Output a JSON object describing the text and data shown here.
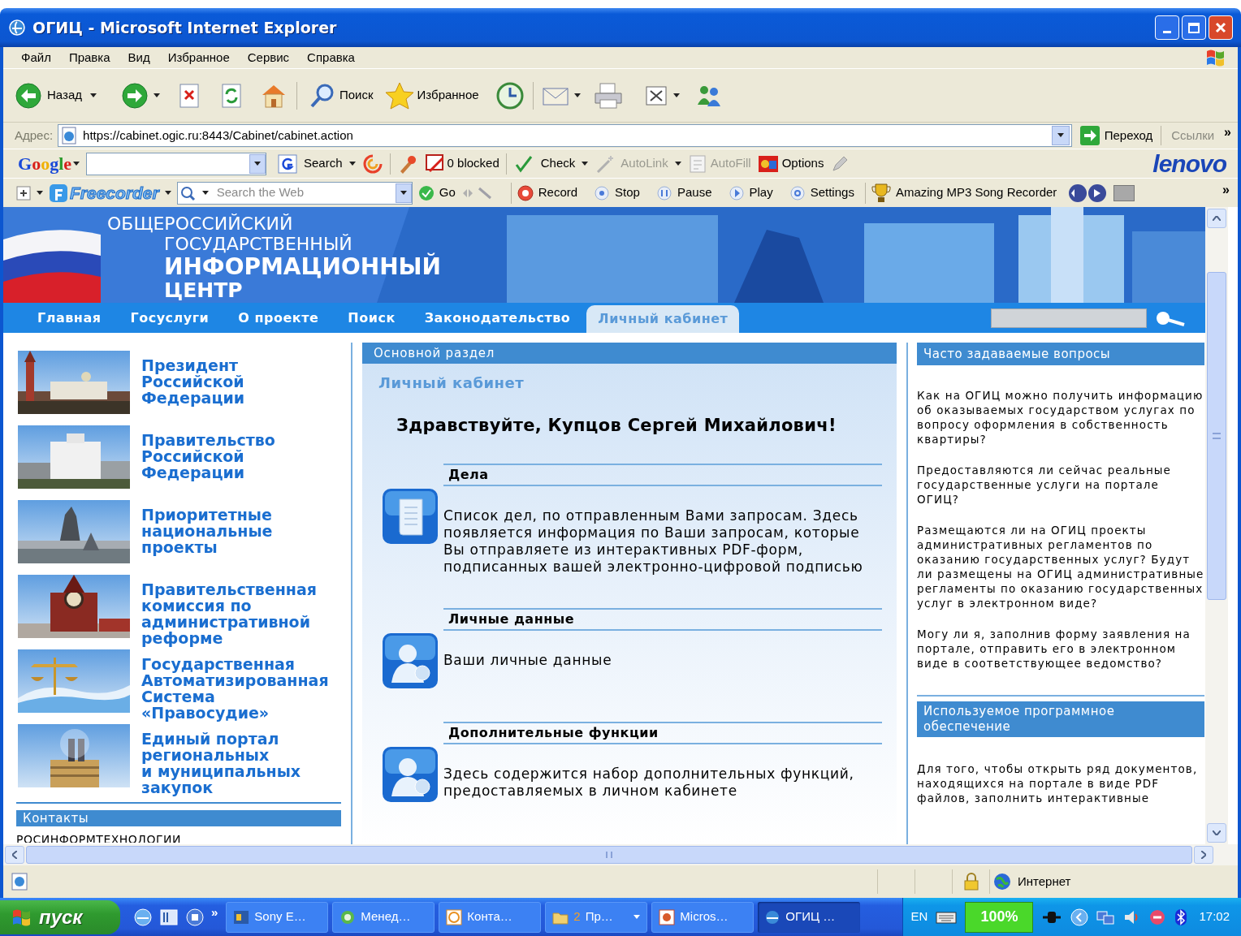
{
  "window": {
    "title": "ОГИЦ - Microsoft Internet Explorer"
  },
  "menu": [
    "Файл",
    "Правка",
    "Вид",
    "Избранное",
    "Сервис",
    "Справка"
  ],
  "toolbar": {
    "back": "Назад",
    "search": "Поиск",
    "favorites": "Избранное"
  },
  "address_bar": {
    "label": "Адрес:",
    "url": "https://cabinet.ogic.ru:8443/Cabinet/cabinet.action",
    "go": "Переход",
    "links": "Ссылки",
    "chevron": "»"
  },
  "google_bar": {
    "logo": "Google",
    "search": "Search",
    "blocked": "0 blocked",
    "check": "Check",
    "autolink": "AutoLink",
    "autofill": "AutoFill",
    "options": "Options",
    "brand": "lenovo"
  },
  "freecorder_bar": {
    "logo": "Freecorder",
    "search_placeholder": "Search the Web",
    "go": "Go",
    "record": "Record",
    "stop": "Stop",
    "pause": "Pause",
    "play": "Play",
    "settings": "Settings",
    "recorder": "Amazing MP3 Song Recorder",
    "chevron": "»"
  },
  "site": {
    "banner": [
      "ОБЩЕРОССИЙСКИЙ",
      "ГОСУДАРСТВЕННЫЙ",
      "ИНФОРМАЦИОННЫЙ",
      "ЦЕНТР"
    ],
    "nav": [
      {
        "label": "Главная",
        "selected": false
      },
      {
        "label": "Госуслуги",
        "selected": false
      },
      {
        "label": "О проекте",
        "selected": false
      },
      {
        "label": "Поиск",
        "selected": false
      },
      {
        "label": "Законодательство",
        "selected": false
      },
      {
        "label": "Личный кабинет",
        "selected": true
      }
    ]
  },
  "left_links": [
    "Президент\nРоссийской\nФедерации",
    "Правительство\nРоссийской\nФедерации",
    "Приоритетные\nнациональные\nпроекты",
    "Правительственная\nкомиссия по\nадминистративной\nреформе",
    "Государственная\nАвтоматизированная\nСистема\n«Правосудие»",
    "Единый портал\nрегиональных\nи муниципальных\nзакупок"
  ],
  "contacts": {
    "heading": "Контакты",
    "text": "РОСИНФОРМТЕХНОЛОГИИ"
  },
  "main": {
    "heading": "Основной раздел",
    "subheading": "Личный кабинет",
    "greeting": "Здравствуйте, Купцов Сергей Михайлович!",
    "sections": [
      {
        "title": "Дела",
        "text": "Список дел, по отправленным Вами запросам. Здесь появляется информация по Ваши запросам, которые Вы отправляете из интерактивных PDF-форм, подписанных вашей электронно-цифровой подписью"
      },
      {
        "title": "Личные данные",
        "text": "Ваши личные данные"
      },
      {
        "title": "Дополнительные функции",
        "text": "Здесь содержится набор дополнительных функций, предоставляемых в личном кабинете"
      }
    ]
  },
  "faq": {
    "heading": "Часто задаваемые вопросы",
    "questions": [
      "Как на ОГИЦ можно получить информацию об оказываемых государством услугах по вопросу оформления в собственность квартиры?",
      "Предоставляются ли сейчас реальные государственные услуги на портале ОГИЦ?",
      "Размещаются ли на ОГИЦ проекты административных регламентов по оказанию государственных услуг? Будут ли размещены на ОГИЦ административные регламенты по оказанию государственных услуг в электронном виде?",
      "Могу ли я, заполнив форму заявления на портале, отправить его в электронном виде в соответствующее ведомство?"
    ]
  },
  "software": {
    "heading": "Используемое программное обеспечение",
    "text": "Для того, чтобы открыть ряд документов, находящихся на портале в виде PDF файлов, заполнить интерактивные"
  },
  "status_bar": {
    "zone": "Интернет"
  },
  "taskbar": {
    "start": "пуск",
    "chevron": "»",
    "tasks": [
      {
        "label": "Sony E…",
        "selected": false
      },
      {
        "label": "Менед…",
        "selected": false
      },
      {
        "label": "Конта…",
        "selected": false
      },
      {
        "count": "2",
        "label": "Пр…",
        "selected": false
      },
      {
        "label": "Micros…",
        "selected": false
      },
      {
        "label": "ОГИЦ …",
        "selected": true
      }
    ],
    "lang": "EN",
    "battery": "100%",
    "clock": "17:02"
  }
}
